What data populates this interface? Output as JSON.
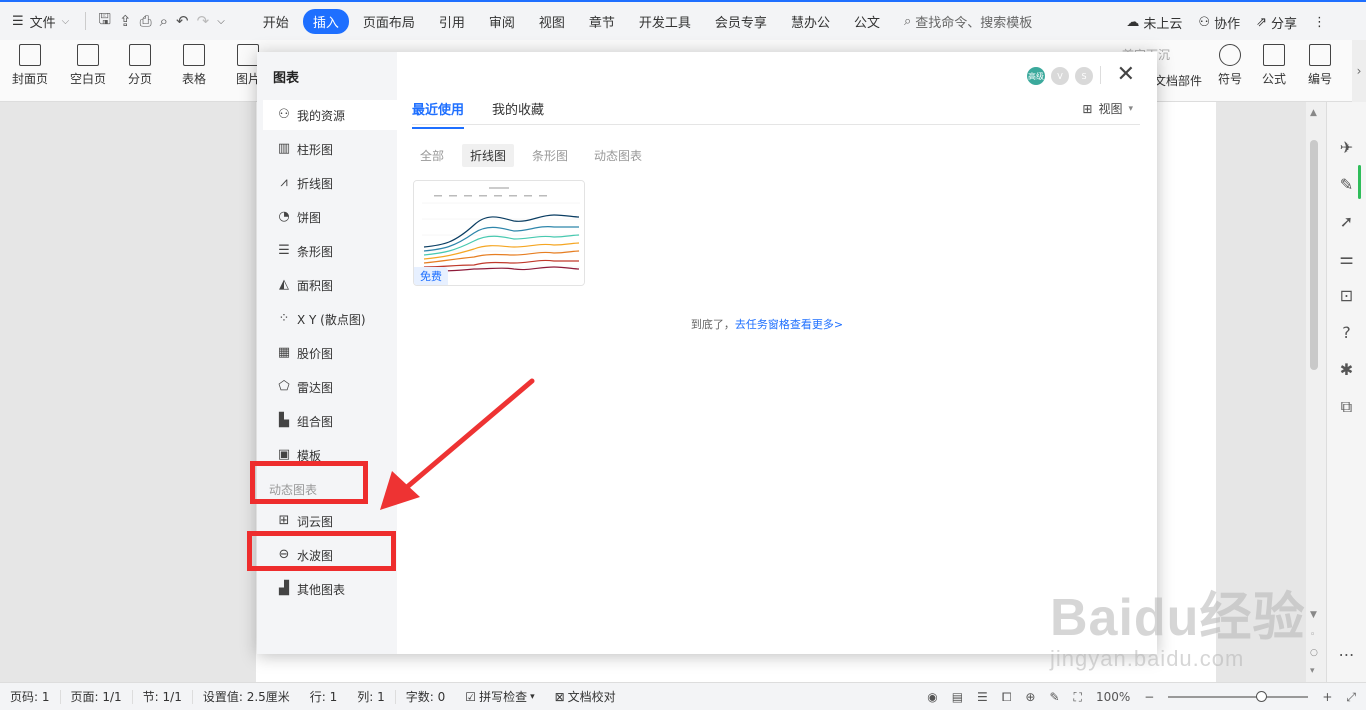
{
  "menubar": {
    "file_label": "文件",
    "tabs": [
      {
        "label": "开始",
        "active": false
      },
      {
        "label": "插入",
        "active": true
      },
      {
        "label": "页面布局",
        "active": false
      },
      {
        "label": "引用",
        "active": false
      },
      {
        "label": "审阅",
        "active": false
      },
      {
        "label": "视图",
        "active": false
      },
      {
        "label": "章节",
        "active": false
      },
      {
        "label": "开发工具",
        "active": false
      },
      {
        "label": "会员专享",
        "active": false
      },
      {
        "label": "慧办公",
        "active": false
      },
      {
        "label": "公文",
        "active": false
      }
    ],
    "search_label": "查找命令、搜索模板",
    "cloud": "未上云",
    "collab": "协作",
    "share": "分享"
  },
  "ribbon": {
    "cover": "封面页",
    "blank": "空白页",
    "pagebreak": "分页",
    "table": "表格",
    "picture": "图片",
    "sink": "首字下沉",
    "docparts": "文档部件",
    "symbol": "符号",
    "formula": "公式",
    "number": "编号"
  },
  "dialog": {
    "title": "图表",
    "nav": [
      {
        "label": "我的资源",
        "icon": "user-icon"
      },
      {
        "label": "柱形图",
        "icon": "column-chart-icon"
      },
      {
        "label": "折线图",
        "icon": "line-chart-icon"
      },
      {
        "label": "饼图",
        "icon": "pie-chart-icon"
      },
      {
        "label": "条形图",
        "icon": "bar-chart-icon"
      },
      {
        "label": "面积图",
        "icon": "area-chart-icon"
      },
      {
        "label": "X Y (散点图)",
        "icon": "scatter-chart-icon"
      },
      {
        "label": "股价图",
        "icon": "stock-chart-icon"
      },
      {
        "label": "雷达图",
        "icon": "radar-chart-icon"
      },
      {
        "label": "组合图",
        "icon": "combo-chart-icon"
      },
      {
        "label": "模板",
        "icon": "template-icon"
      }
    ],
    "group_label": "动态图表",
    "dynamic_nav": [
      {
        "label": "词云图",
        "icon": "wordcloud-icon"
      },
      {
        "label": "水波图",
        "icon": "water-wave-icon"
      },
      {
        "label": "其他图表",
        "icon": "other-chart-icon"
      }
    ],
    "main_tabs": [
      {
        "label": "最近使用",
        "active": true
      },
      {
        "label": "我的收藏",
        "active": false
      }
    ],
    "view_label": "视图",
    "filters": [
      {
        "label": "全部",
        "active": false
      },
      {
        "label": "折线图",
        "active": true
      },
      {
        "label": "条形图",
        "active": false
      },
      {
        "label": "动态图表",
        "active": false
      }
    ],
    "free_badge": "免费",
    "end_note": "到底了，",
    "end_link": "去任务窗格查看更多>",
    "avatar_text": "高级"
  },
  "statusbar": {
    "page_no": "页码: 1",
    "pages": "页面: 1/1",
    "section": "节: 1/1",
    "setting": "设置值: 2.5厘米",
    "row": "行: 1",
    "col": "列: 1",
    "words": "字数: 0",
    "spell": "拼写检查",
    "proof": "文档校对",
    "zoom": "100%",
    "zoom_level": 0.66
  },
  "watermark": {
    "big": "Baidu经验",
    "small": "jingyan.baidu.com"
  }
}
